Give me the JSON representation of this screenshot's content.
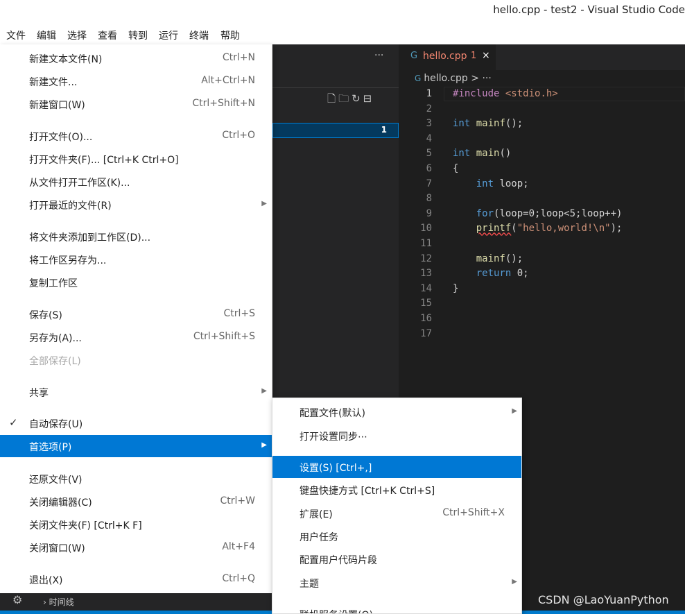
{
  "window": {
    "title": "hello.cpp - test2 - Visual Studio Code"
  },
  "menubar": [
    "文件",
    "编辑",
    "选择",
    "查看",
    "转到",
    "运行",
    "终端",
    "帮助"
  ],
  "file_menu": [
    {
      "label": "新建文本文件(N)",
      "shortcut": "Ctrl+N"
    },
    {
      "label": "新建文件...",
      "shortcut": "Alt+Ctrl+N"
    },
    {
      "label": "新建窗口(W)",
      "shortcut": "Ctrl+Shift+N"
    },
    {
      "label": "打开文件(O)...",
      "shortcut": "Ctrl+O"
    },
    {
      "label": "打开文件夹(F)... [Ctrl+K Ctrl+O]",
      "shortcut": ""
    },
    {
      "label": "从文件打开工作区(K)...",
      "shortcut": ""
    },
    {
      "label": "打开最近的文件(R)",
      "shortcut": ""
    },
    {
      "label": "将文件夹添加到工作区(D)...",
      "shortcut": ""
    },
    {
      "label": "将工作区另存为...",
      "shortcut": ""
    },
    {
      "label": "复制工作区",
      "shortcut": ""
    },
    {
      "label": "保存(S)",
      "shortcut": "Ctrl+S"
    },
    {
      "label": "另存为(A)...",
      "shortcut": "Ctrl+Shift+S"
    },
    {
      "label": "全部保存(L)",
      "shortcut": ""
    },
    {
      "label": "共享",
      "shortcut": ""
    },
    {
      "label": "自动保存(U)",
      "shortcut": ""
    },
    {
      "label": "首选项(P)",
      "shortcut": ""
    },
    {
      "label": "还原文件(V)",
      "shortcut": ""
    },
    {
      "label": "关闭编辑器(C)",
      "shortcut": "Ctrl+W"
    },
    {
      "label": "关闭文件夹(F) [Ctrl+K F]",
      "shortcut": ""
    },
    {
      "label": "关闭窗口(W)",
      "shortcut": "Alt+F4"
    },
    {
      "label": "退出(X)",
      "shortcut": "Ctrl+Q"
    }
  ],
  "prefs_submenu": [
    {
      "label": "配置文件(默认)",
      "shortcut": ""
    },
    {
      "label": "打开设置同步⋯",
      "shortcut": ""
    },
    {
      "label": "设置(S) [Ctrl+,]",
      "shortcut": ""
    },
    {
      "label": "键盘快捷方式 [Ctrl+K Ctrl+S]",
      "shortcut": ""
    },
    {
      "label": "扩展(E)",
      "shortcut": "Ctrl+Shift+X"
    },
    {
      "label": "用户任务",
      "shortcut": ""
    },
    {
      "label": "配置用户代码片段",
      "shortcut": ""
    },
    {
      "label": "主题",
      "shortcut": ""
    },
    {
      "label": "联机服务设置(O)",
      "shortcut": ""
    }
  ],
  "explorer": {
    "dots": "···",
    "badge": "1",
    "timeline_label": "时间线"
  },
  "tab": {
    "label": "hello.cpp",
    "count": "1",
    "close": "×"
  },
  "breadcrumb": {
    "file": "hello.cpp",
    "rest": "> ···"
  },
  "code": {
    "line_numbers": [
      "1",
      "2",
      "3",
      "4",
      "5",
      "6",
      "7",
      "8",
      "9",
      "10",
      "11",
      "12",
      "13",
      "14",
      "15",
      "16",
      "17"
    ],
    "lines": [
      "#include <stdio.h>",
      "",
      "int mainf();",
      "",
      "int main()",
      "{",
      "    int loop;",
      "",
      "    for(loop=0;loop<5;loop++)",
      "    printf(\"hello,world!\\n\");",
      "",
      "    mainf();",
      "    return 0;",
      "}",
      "",
      "",
      ""
    ]
  },
  "watermark": "CSDN @LaoYuanPython"
}
